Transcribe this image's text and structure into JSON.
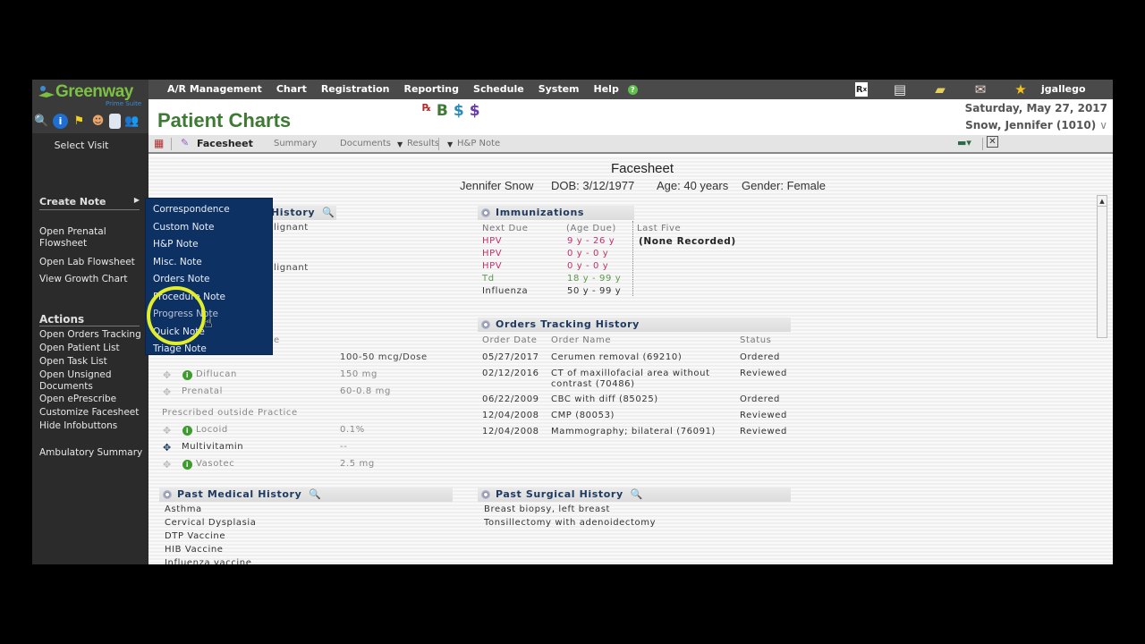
{
  "app": {
    "logo": "Greenway",
    "logo_sub": "Prime Suite",
    "nav": [
      "A/R Management",
      "Chart",
      "Registration",
      "Reporting",
      "Schedule",
      "System",
      "Help"
    ],
    "username": "jgallego",
    "page_title": "Patient Charts",
    "date": "Saturday, May 27, 2017",
    "patient": "Snow, Jennifer (1010)",
    "header_icons": {
      "b": "B",
      "dollar1": "$",
      "dollar2": "$"
    }
  },
  "sidebar": {
    "select_visit": "Select Visit",
    "create_note": "Create Note",
    "links1": [
      "Open Prenatal Flowsheet",
      "Open Lab Flowsheet",
      "View Growth Chart"
    ],
    "actions_title": "Actions",
    "actions": [
      "Open Orders Tracking",
      "Open Patient List",
      "Open Task List",
      "Open Unsigned Documents",
      "Open ePrescribe",
      "Customize Facesheet",
      "Hide Infobuttons"
    ],
    "ambulatory": "Ambulatory Summary"
  },
  "tabs": {
    "facesheet": "Facesheet",
    "summary": "Summary",
    "documents": "Documents",
    "results": "Results",
    "hp_note": "H&P Note"
  },
  "create_note_menu": [
    "Correspondence",
    "Custom Note",
    "H&P Note",
    "Misc. Note",
    "Orders Note",
    "Procedure Note",
    "Progress Note",
    "Quick Note",
    "Triage Note"
  ],
  "facesheet": {
    "title": "Facesheet",
    "patient_name": "Jennifer Snow",
    "dob": "DOB: 3/12/1977",
    "age": "Age: 40 years",
    "gender": "Gender: Female",
    "hidden_section_title": "History",
    "hidden_rows": [
      "lignant",
      "lignant",
      "e"
    ],
    "medications": {
      "rows": [
        {
          "name": "",
          "dose": "100-50 mcg/Dose",
          "info": false
        },
        {
          "name": "Diflucan",
          "dose": "150 mg",
          "info": true
        },
        {
          "name": "Prenatal",
          "dose": "60-0.8 mg",
          "info": false
        }
      ],
      "outside_label": "Prescribed outside Practice",
      "outside_rows": [
        {
          "name": "Locoid",
          "dose": "0.1%",
          "info": true
        },
        {
          "name": "Multivitamin",
          "dose": "--",
          "info": false
        },
        {
          "name": "Vasotec",
          "dose": "2.5 mg",
          "info": true
        }
      ]
    },
    "immunizations": {
      "title": "Immunizations",
      "col_next_due": "Next Due",
      "col_age_due": "(Age Due)",
      "col_last_five": "Last Five",
      "last_five_value": "(None Recorded)",
      "rows": [
        {
          "name": "HPV",
          "age": "9 y - 26 y",
          "color": "#c0306a"
        },
        {
          "name": "HPV",
          "age": "0 y - 0 y",
          "color": "#c0306a"
        },
        {
          "name": "HPV",
          "age": "0 y - 0 y",
          "color": "#c0306a"
        },
        {
          "name": "Td",
          "age": "18 y - 99 y",
          "color": "#5a9a4a"
        },
        {
          "name": "Influenza",
          "age": "50 y - 99 y",
          "color": "#333333"
        }
      ]
    },
    "orders": {
      "title": "Orders Tracking History",
      "col_date": "Order Date",
      "col_name": "Order Name",
      "col_status": "Status",
      "rows": [
        {
          "date": "05/27/2017",
          "name": "Cerumen removal (69210)",
          "name2": "",
          "status": "Ordered"
        },
        {
          "date": "02/12/2016",
          "name": "CT of maxillofacial area without",
          "name2": "contrast (70486)",
          "status": "Reviewed"
        },
        {
          "date": "06/22/2009",
          "name": "CBC with diff (85025)",
          "name2": "",
          "status": "Ordered"
        },
        {
          "date": "12/04/2008",
          "name": "CMP (80053)",
          "name2": "",
          "status": "Reviewed"
        },
        {
          "date": "12/04/2008",
          "name": "Mammography; bilateral (76091)",
          "name2": "",
          "status": "Reviewed"
        }
      ]
    },
    "past_medical": {
      "title": "Past Medical History",
      "items": [
        "Asthma",
        "Cervical Dysplasia",
        "DTP Vaccine",
        "HIB Vaccine",
        "Influenza vaccine"
      ]
    },
    "past_surgical": {
      "title": "Past Surgical History",
      "items": [
        "Breast biopsy, left breast",
        "Tonsillectomy with adenoidectomy"
      ]
    }
  }
}
